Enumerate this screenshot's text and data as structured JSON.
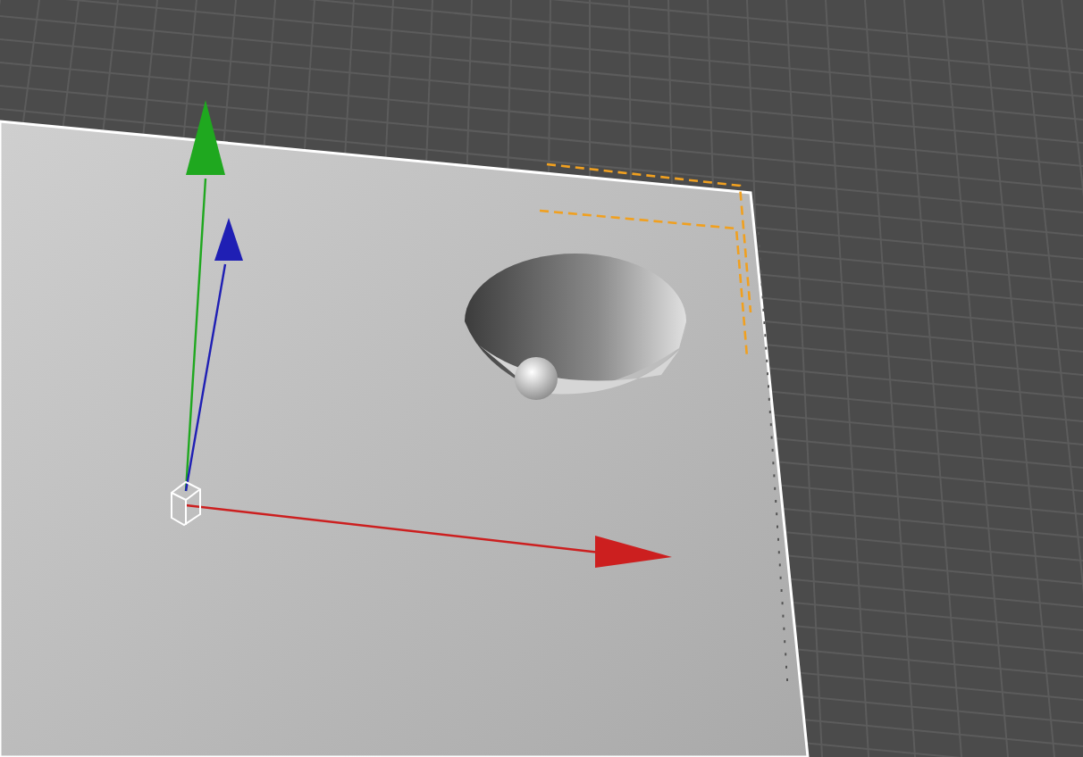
{
  "gizmo": {
    "axes": [
      {
        "kind": "x",
        "color": "#cc1f1f"
      },
      {
        "kind": "y",
        "color": "#1fa81f"
      },
      {
        "kind": "z",
        "color": "#1f1fb4"
      }
    ]
  }
}
